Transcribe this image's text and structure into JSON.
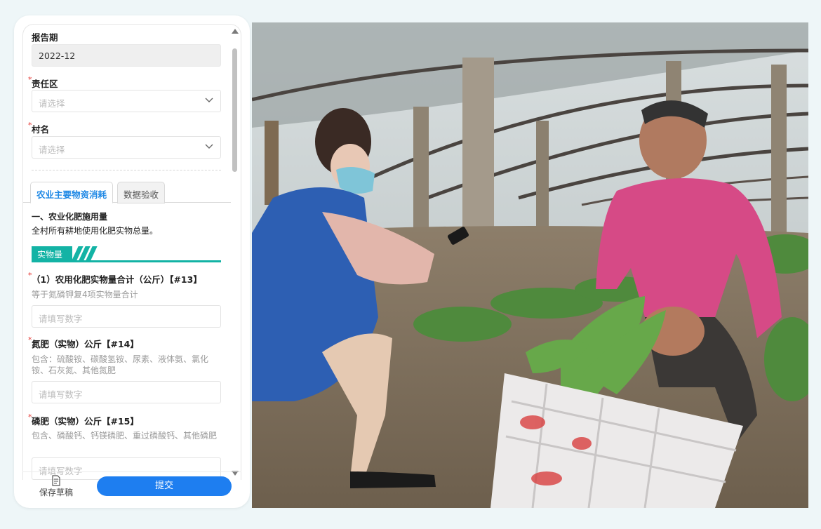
{
  "form": {
    "report_period": {
      "label": "报告期",
      "value": "2022-12"
    },
    "responsibility_area": {
      "required_mark": "*",
      "label": "责任区",
      "placeholder": "请选择"
    },
    "village": {
      "required_mark": "*",
      "label": "村名",
      "placeholder": "请选择"
    },
    "tabs": [
      {
        "label": "农业主要物资消耗",
        "active": true
      },
      {
        "label": "数据验收",
        "active": false
      }
    ],
    "section": {
      "title": "一、农业化肥施用量",
      "description": "全村所有耕地使用化肥实物总量。",
      "banner_label": "实物量"
    },
    "questions": [
      {
        "required_mark": "*",
        "label": "（1）农用化肥实物量合计（公斤）【#13】",
        "hint": "等于氮磷钾复4项实物量合计",
        "placeholder": "请填写数字"
      },
      {
        "required_mark": "*",
        "label": "氮肥（实物）公斤【#14】",
        "hint": "包含：硫酸铵、碳酸氢铵、尿素、液体氨、氯化铵、石灰氮、其他氮肥",
        "placeholder": "请填写数字"
      },
      {
        "required_mark": "*",
        "label": "磷肥（实物）公斤【#15】",
        "hint": "包含、磷酸钙、钙镁磷肥、重过磷酸钙、其他磷肥",
        "placeholder": "请填写数字"
      }
    ]
  },
  "footer": {
    "save_draft_label": "保存草稿",
    "submit_label": "提交"
  },
  "colors": {
    "accent": "#1e7ef0",
    "teal": "#13b3a5",
    "required": "#e53935"
  },
  "icons": {
    "select_arrow": "chevron-down-icon",
    "draft": "document-edit-icon"
  }
}
